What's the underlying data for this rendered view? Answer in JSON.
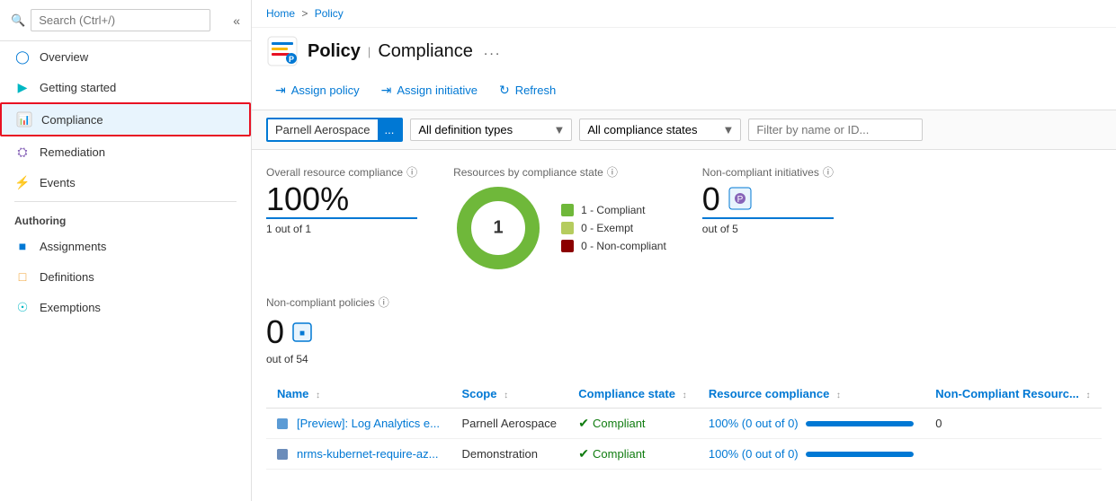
{
  "breadcrumb": {
    "home": "Home",
    "separator": ">",
    "policy": "Policy"
  },
  "page": {
    "icon_label": "policy-icon",
    "title": "Policy",
    "separator": "|",
    "subtitle": "Compliance",
    "more": "..."
  },
  "toolbar": {
    "assign_policy": "Assign policy",
    "assign_initiative": "Assign initiative",
    "refresh": "Refresh"
  },
  "filters": {
    "scope_value": "Parnell Aerospace",
    "definition_types": "All definition types",
    "compliance_states": "All compliance states",
    "filter_placeholder": "Filter by name or ID..."
  },
  "stats": {
    "overall_label": "Overall resource compliance",
    "overall_value": "100%",
    "overall_sub": "1 out of 1",
    "chart_label": "Resources by compliance state",
    "chart_center": "1",
    "legend": [
      {
        "color": "#6fb83a",
        "label": "1 - Compliant"
      },
      {
        "color": "#b5cc5e",
        "label": "0 - Exempt"
      },
      {
        "color": "#8b0000",
        "label": "0 - Non-compliant"
      }
    ],
    "non_compliant_initiatives_label": "Non-compliant initiatives",
    "non_compliant_initiatives_value": "0",
    "non_compliant_initiatives_sub": "out of 5"
  },
  "nc_policies": {
    "label": "Non-compliant policies",
    "value": "0",
    "sub": "out of 54"
  },
  "table": {
    "columns": [
      {
        "label": "Name",
        "sortable": true
      },
      {
        "label": "Scope",
        "sortable": true
      },
      {
        "label": "Compliance state",
        "sortable": true
      },
      {
        "label": "Resource compliance",
        "sortable": true
      },
      {
        "label": "Non-Compliant Resourc...",
        "sortable": true
      }
    ],
    "rows": [
      {
        "name": "[Preview]: Log Analytics e...",
        "scope": "Parnell Aerospace",
        "compliance_state": "Compliant",
        "resource_compliance": "100% (0 out of 0)",
        "resource_compliance_pct": 100,
        "non_compliant": "0"
      },
      {
        "name": "nrms-kubernet-require-az...",
        "scope": "Demonstration",
        "compliance_state": "Compliant",
        "resource_compliance": "100% (0 out of 0)",
        "resource_compliance_pct": 100,
        "non_compliant": ""
      }
    ]
  },
  "nav": {
    "overview": "Overview",
    "getting_started": "Getting started",
    "compliance": "Compliance",
    "remediation": "Remediation",
    "events": "Events",
    "authoring_label": "Authoring",
    "assignments": "Assignments",
    "definitions": "Definitions",
    "exemptions": "Exemptions"
  },
  "search": {
    "placeholder": "Search (Ctrl+/)"
  }
}
